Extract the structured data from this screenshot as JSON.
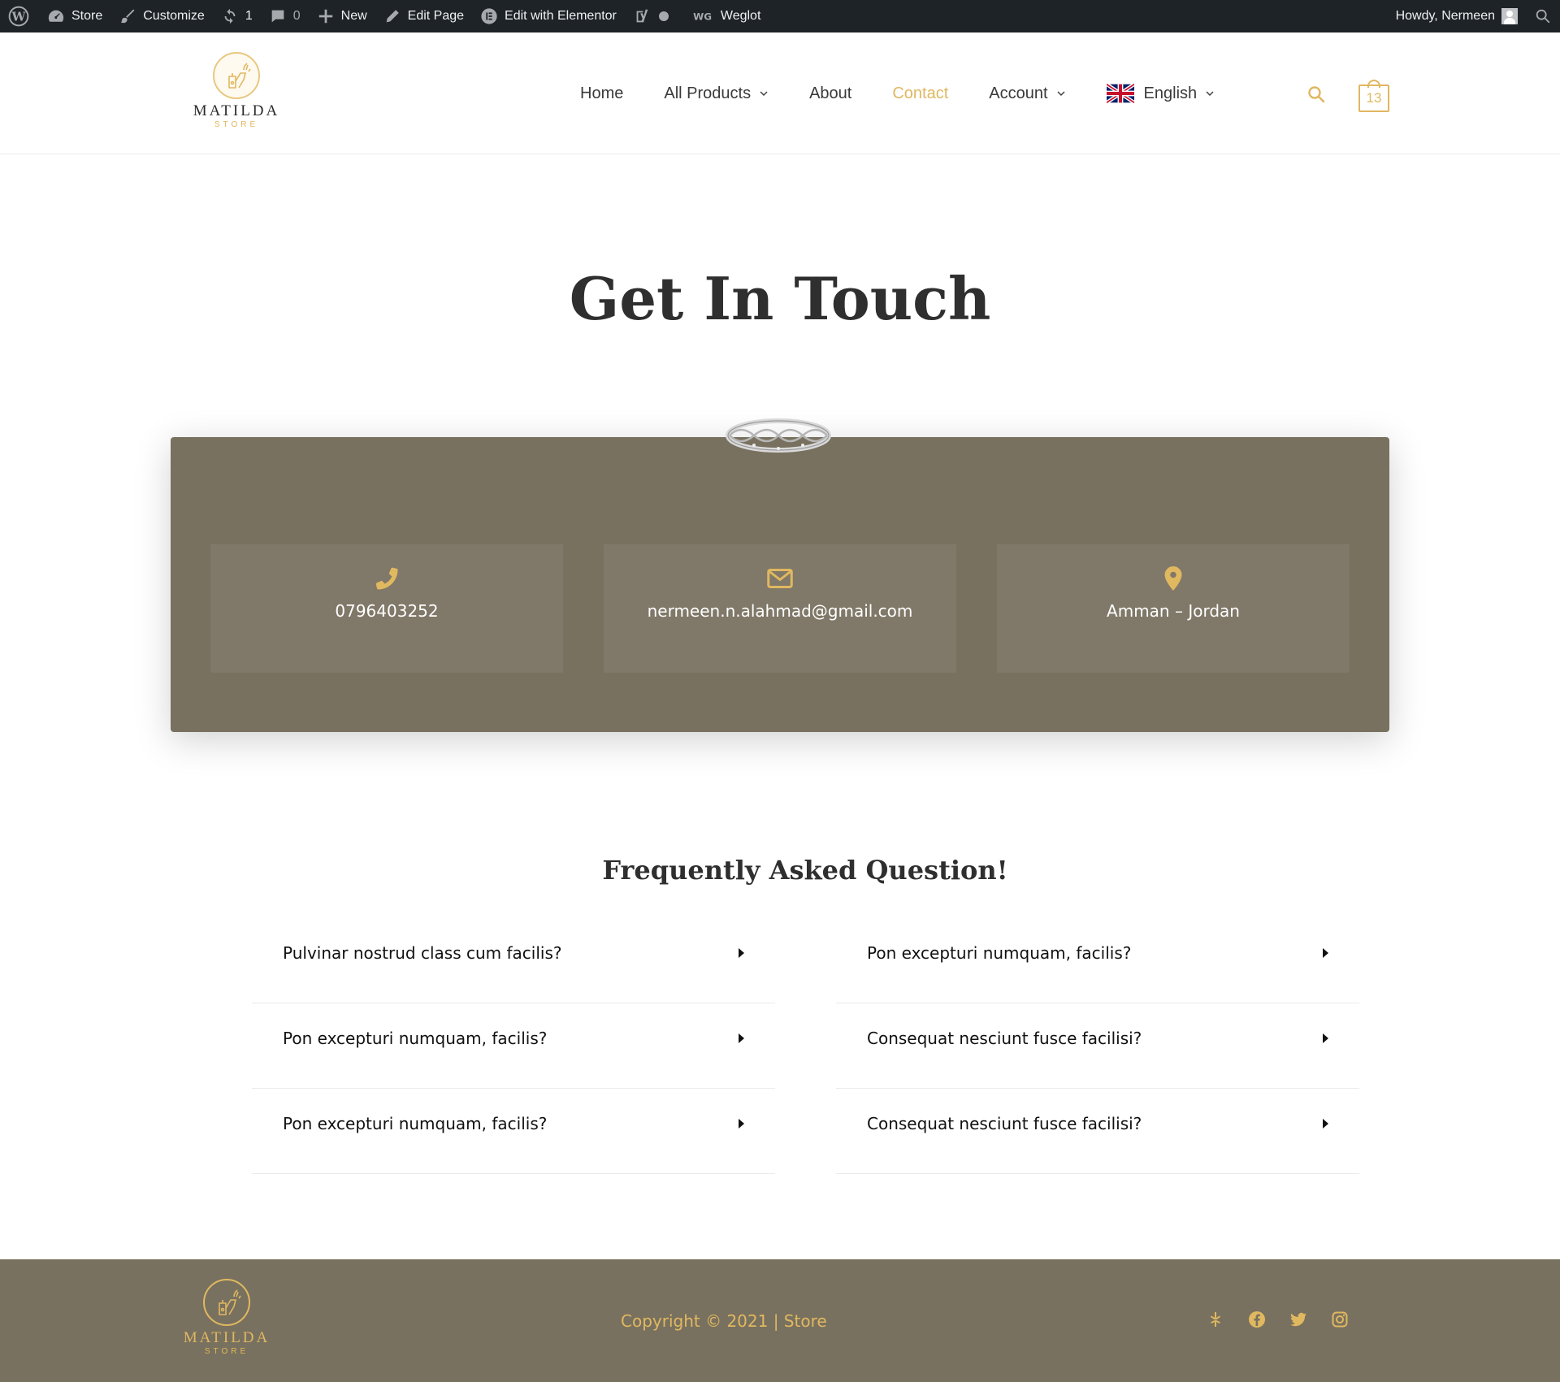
{
  "admin_bar": {
    "site": "Store",
    "customize": "Customize",
    "updates": "1",
    "comments": "0",
    "new": "New",
    "edit_page": "Edit Page",
    "elementor": "Edit with Elementor",
    "weglot": "Weglot",
    "greeting": "Howdy, Nermeen"
  },
  "header": {
    "logo_name": "MATILDA",
    "logo_sub": "STORE",
    "nav": [
      {
        "label": "Home"
      },
      {
        "label": "All Products"
      },
      {
        "label": "About"
      },
      {
        "label": "Contact"
      },
      {
        "label": "Account"
      },
      {
        "label": "English"
      }
    ],
    "cart_count": "13"
  },
  "colors": {
    "accent": "#e0b860",
    "card_bg": "#79715f",
    "box_bg": "#807868",
    "adminbar_bg": "#1d2327"
  },
  "hero": {
    "title": "Get In Touch"
  },
  "contact": {
    "phone": "0796403252",
    "email": "nermeen.n.alahmad@gmail.com",
    "location": "Amman – Jordan"
  },
  "faq": {
    "title": "Frequently Asked Question!",
    "left": [
      "Pulvinar nostrud class cum facilis?",
      "Pon excepturi numquam, facilis?",
      "Pon excepturi numquam, facilis?"
    ],
    "right": [
      "Pon excepturi numquam, facilis?",
      "Consequat nesciunt fusce facilisi?",
      "Consequat nesciunt fusce facilisi?"
    ]
  },
  "footer": {
    "logo_name": "MATILDA",
    "logo_sub": "STORE",
    "copyright": "Copyright © 2021 | Store",
    "socials": [
      "yelp-icon",
      "facebook-icon",
      "twitter-icon",
      "instagram-icon"
    ]
  }
}
